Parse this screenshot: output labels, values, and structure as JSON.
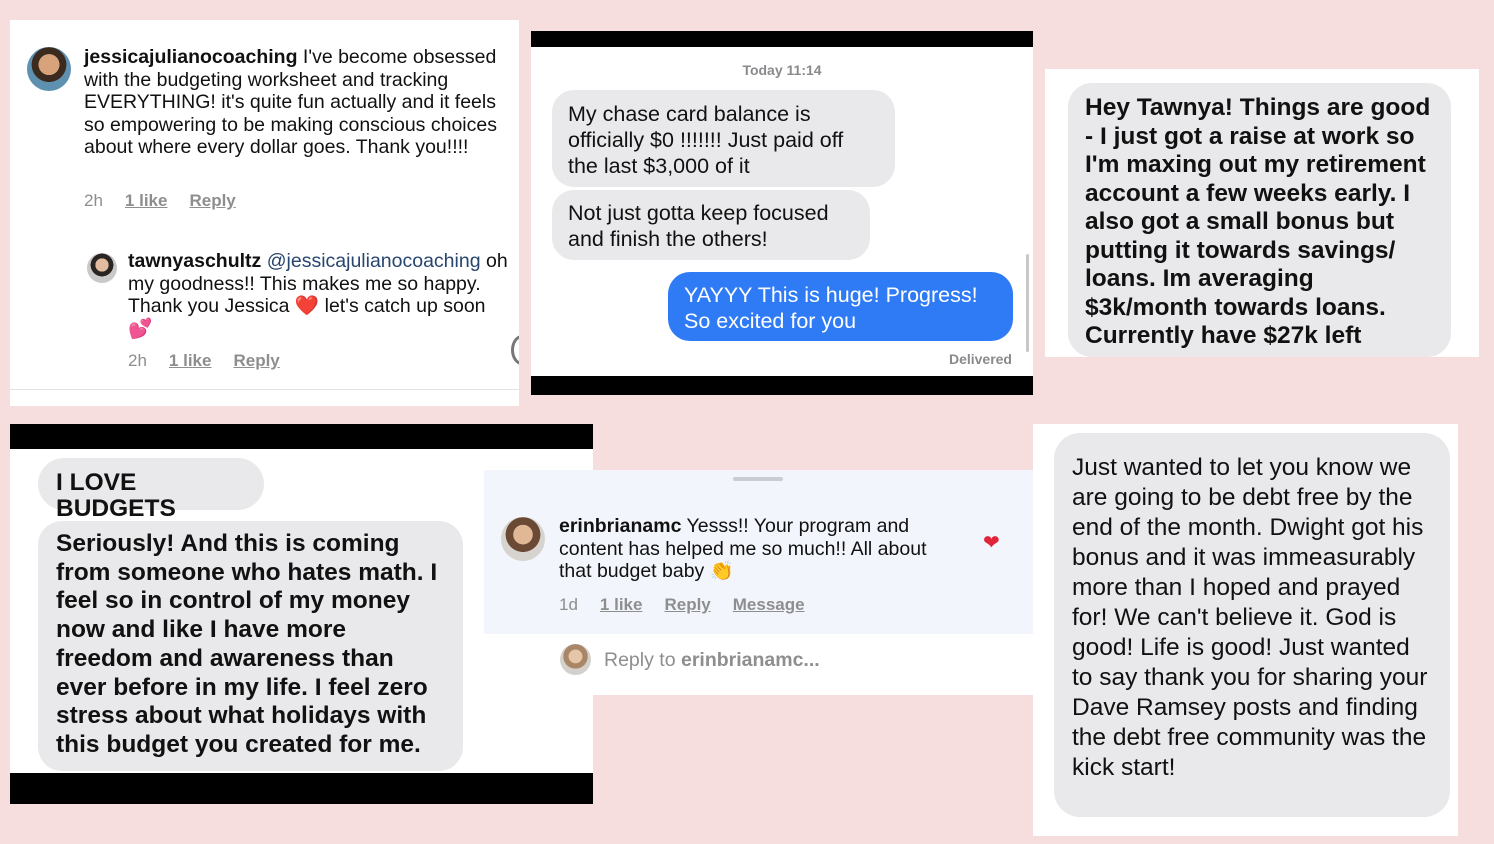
{
  "panel1": {
    "comment1": {
      "username": "jessicajulianocoaching",
      "text": "I've become obsessed with the budgeting worksheet and tracking EVERYTHING! it's quite fun actually and it feels so empowering to be making conscious choices about where every dollar goes. Thank you!!!!",
      "time": "2h",
      "likes": "1 like",
      "reply": "Reply"
    },
    "comment2": {
      "username": "tawnyaschultz",
      "mention": "@jessicajulianocoaching",
      "text_a": "oh my goodness!! This makes me so happy. Thank you Jessica",
      "heart": "❤️",
      "text_b": "let's catch up soon",
      "emoji": "💕",
      "time": "2h",
      "likes": "1 like",
      "reply": "Reply"
    }
  },
  "panel2": {
    "timestamp": "Today 11:14",
    "msg1": "My chase card balance is officially $0 !!!!!!! Just paid off the last $3,000 of it",
    "msg2": "Not just gotta keep focused and finish the others!",
    "msg3": "YAYYY This is huge! Progress! So excited for you",
    "status": "Delivered"
  },
  "panel3": {
    "message": "Hey Tawnya! Things are good - I just got a raise at work so I'm maxing out my retirement account a few weeks early. I also got a small bonus but putting it towards savings/ loans. Im averaging $3k/month towards loans. Currently have $27k left"
  },
  "panel4": {
    "msg1": "I LOVE BUDGETS",
    "msg2": "Seriously! And this is coming from someone who hates math. I feel so in control of my money now and like I have more freedom and awareness than ever before in my life. I feel zero stress about what holidays with this budget you created for me."
  },
  "panel5": {
    "username": "erinbrianamc",
    "text": "Yesss!! Your program and content has helped me so much!! All about that budget baby",
    "emoji": "👏",
    "time": "1d",
    "likes": "1 like",
    "reply": "Reply",
    "message": "Message",
    "reply_prefix": "Reply to",
    "reply_target": "erinbrianamc..."
  },
  "panel6": {
    "message": "Just wanted to let you know we are going to be debt free by the end of the month. Dwight got his bonus and it was immeasurably more than I hoped and prayed for!  We can't believe it. God is good! Life is good!  Just wanted to say thank you for sharing your Dave Ramsey posts and finding the debt free community was the kick start!"
  },
  "colors": {
    "background": "#f7dede",
    "imessage_blue": "#2f7bf6",
    "bubble_gray": "#e9e9eb",
    "like_red": "#e0243a"
  }
}
